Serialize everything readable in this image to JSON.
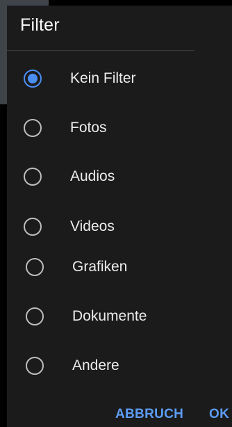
{
  "dialog": {
    "title": "Filter",
    "options": [
      {
        "label": "Kein Filter",
        "selected": true
      },
      {
        "label": "Fotos",
        "selected": false
      },
      {
        "label": "Audios",
        "selected": false
      },
      {
        "label": "Videos",
        "selected": false
      },
      {
        "label": "Grafiken",
        "selected": false
      },
      {
        "label": "Dokumente",
        "selected": false
      },
      {
        "label": "Andere",
        "selected": false
      }
    ],
    "cancel_label": "ABBRUCH",
    "ok_label": "OK"
  },
  "colors": {
    "accent": "#4a8ef5",
    "button_text": "#5c9cf5",
    "dialog_background": "#1b1b1c"
  }
}
